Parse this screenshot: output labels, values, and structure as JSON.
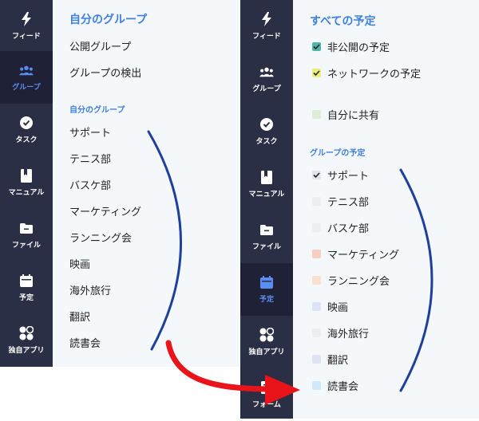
{
  "left_panel": {
    "rail": [
      {
        "label": "フィード",
        "icon": "bolt-icon",
        "active": false
      },
      {
        "label": "グループ",
        "icon": "group-icon",
        "active": true
      },
      {
        "label": "タスク",
        "icon": "check-circle-icon",
        "active": false
      },
      {
        "label": "マニュアル",
        "icon": "book-icon",
        "active": false
      },
      {
        "label": "ファイル",
        "icon": "folder-icon",
        "active": false
      },
      {
        "label": "予定",
        "icon": "calendar-icon",
        "active": false
      },
      {
        "label": "独自アプリ",
        "icon": "apps-icon",
        "active": false
      }
    ],
    "menu": {
      "my_groups_link": "自分のグループ",
      "public_groups": "公開グループ",
      "search_groups": "グループの検出",
      "section_title": "自分のグループ",
      "groups": [
        "サポート",
        "テニス部",
        "バスケ部",
        "マーケティング",
        "ランニング会",
        "映画",
        "海外旅行",
        "翻訳",
        "読書会"
      ]
    }
  },
  "right_panel": {
    "rail": [
      {
        "label": "フィード",
        "icon": "bolt-icon",
        "active": false
      },
      {
        "label": "グループ",
        "icon": "group-icon",
        "active": false
      },
      {
        "label": "タスク",
        "icon": "check-circle-icon",
        "active": false
      },
      {
        "label": "マニュアル",
        "icon": "book-icon",
        "active": false
      },
      {
        "label": "ファイル",
        "icon": "folder-icon",
        "active": false
      },
      {
        "label": "予定",
        "icon": "calendar-icon",
        "active": true
      },
      {
        "label": "独自アプリ",
        "icon": "apps-icon",
        "active": false
      },
      {
        "label": "フォーム",
        "icon": "form-icon",
        "active": false
      }
    ],
    "calendar": {
      "all_events": "すべての予定",
      "filters": [
        {
          "label": "非公開の予定",
          "color": "#4fb5a8",
          "checked": true
        },
        {
          "label": "ネットワークの予定",
          "color": "#e9ef7a",
          "checked": true
        },
        {
          "label": "自分に共有",
          "color": "#dcefd6",
          "checked": false
        }
      ],
      "section_title": "グループの予定",
      "groups": [
        {
          "label": "サポート",
          "color": "#e3e5ea",
          "checked": true
        },
        {
          "label": "テニス部",
          "color": "#eceef2",
          "checked": false
        },
        {
          "label": "バスケ部",
          "color": "#eceef2",
          "checked": false
        },
        {
          "label": "マーケティング",
          "color": "#f7cfc0",
          "checked": false
        },
        {
          "label": "ランニング会",
          "color": "#fbe0d0",
          "checked": false
        },
        {
          "label": "映画",
          "color": "#dde3f7",
          "checked": false
        },
        {
          "label": "海外旅行",
          "color": "#eceef2",
          "checked": false
        },
        {
          "label": "翻訳",
          "color": "#dde3f5",
          "checked": false
        },
        {
          "label": "読書会",
          "color": "#cfe8fb",
          "checked": false
        }
      ]
    }
  },
  "colors": {
    "rail_bg": "#2b2f45",
    "rail_active_bg": "#1f2236",
    "accent": "#3e7fe0",
    "bracket": "#1f3f9e",
    "arrow": "#e8141a"
  }
}
